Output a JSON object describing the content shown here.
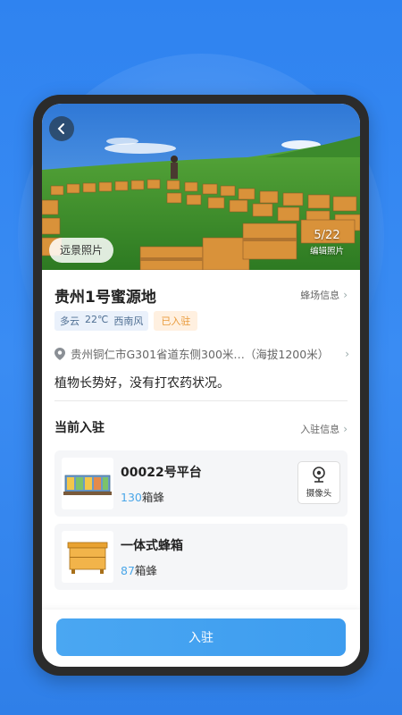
{
  "hero": {
    "far_photo_label": "远景照片",
    "photo_counter": "5/22",
    "edit_photo_label": "编辑照片"
  },
  "apiary": {
    "name": "贵州1号蜜源地",
    "info_link": "蜂场信息",
    "weather": {
      "condition": "多云",
      "temperature": "22℃",
      "wind": "西南风"
    },
    "status_tag": "已入驻",
    "address": "贵州铜仁市G301省道东侧300米…（海拔1200米）",
    "description": "植物长势好，没有打农药状况。"
  },
  "current": {
    "title": "当前入驻",
    "info_link": "入驻信息",
    "items": [
      {
        "name": "00022号平台",
        "count": "130",
        "unit": "箱蜂",
        "icon": "beehive-platform-icon",
        "camera_label": "摄像头"
      },
      {
        "name": "一体式蜂箱",
        "count": "87",
        "unit": "箱蜂",
        "icon": "beehive-box-icon"
      }
    ]
  },
  "action": {
    "enter_label": "入驻"
  },
  "colors": {
    "accent": "#3d9cef",
    "status_orange": "#e99a3a",
    "count_blue": "#4aa6e8"
  }
}
